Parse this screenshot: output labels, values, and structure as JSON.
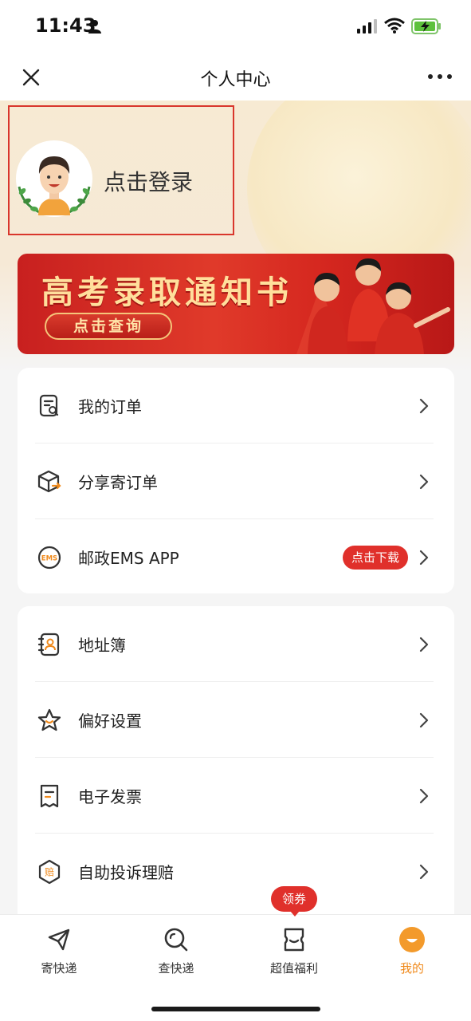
{
  "status_bar": {
    "time": "11:43"
  },
  "nav": {
    "title": "个人中心",
    "close_icon": "close-icon",
    "more_icon": "more-icon"
  },
  "profile": {
    "login_label": "点击登录"
  },
  "banner": {
    "title": "高考录取通知书",
    "button_label": "点击查询"
  },
  "menu_group_1": [
    {
      "label": "我的订单",
      "icon": "order-search-icon"
    },
    {
      "label": "分享寄订单",
      "icon": "share-box-icon"
    },
    {
      "label": "邮政EMS APP",
      "icon": "ems-icon",
      "icon_text": "EMS",
      "badge": "点击下载"
    }
  ],
  "menu_group_2": [
    {
      "label": "地址簿",
      "icon": "address-book-icon"
    },
    {
      "label": "偏好设置",
      "icon": "star-icon"
    },
    {
      "label": "电子发票",
      "icon": "invoice-icon"
    },
    {
      "label": "自助投诉理赔",
      "icon": "claim-icon",
      "icon_text": "赔"
    }
  ],
  "tabbar": {
    "coupon_label": "领券",
    "tabs": [
      {
        "label": "寄快递",
        "icon": "send-icon"
      },
      {
        "label": "查快递",
        "icon": "search-icon"
      },
      {
        "label": "超值福利",
        "icon": "coupon-icon"
      },
      {
        "label": "我的",
        "icon": "profile-smile-icon",
        "active": true
      }
    ]
  },
  "colors": {
    "accent": "#e0302b",
    "tab_active": "#f08a1c",
    "login_highlight": "#d9362c"
  }
}
